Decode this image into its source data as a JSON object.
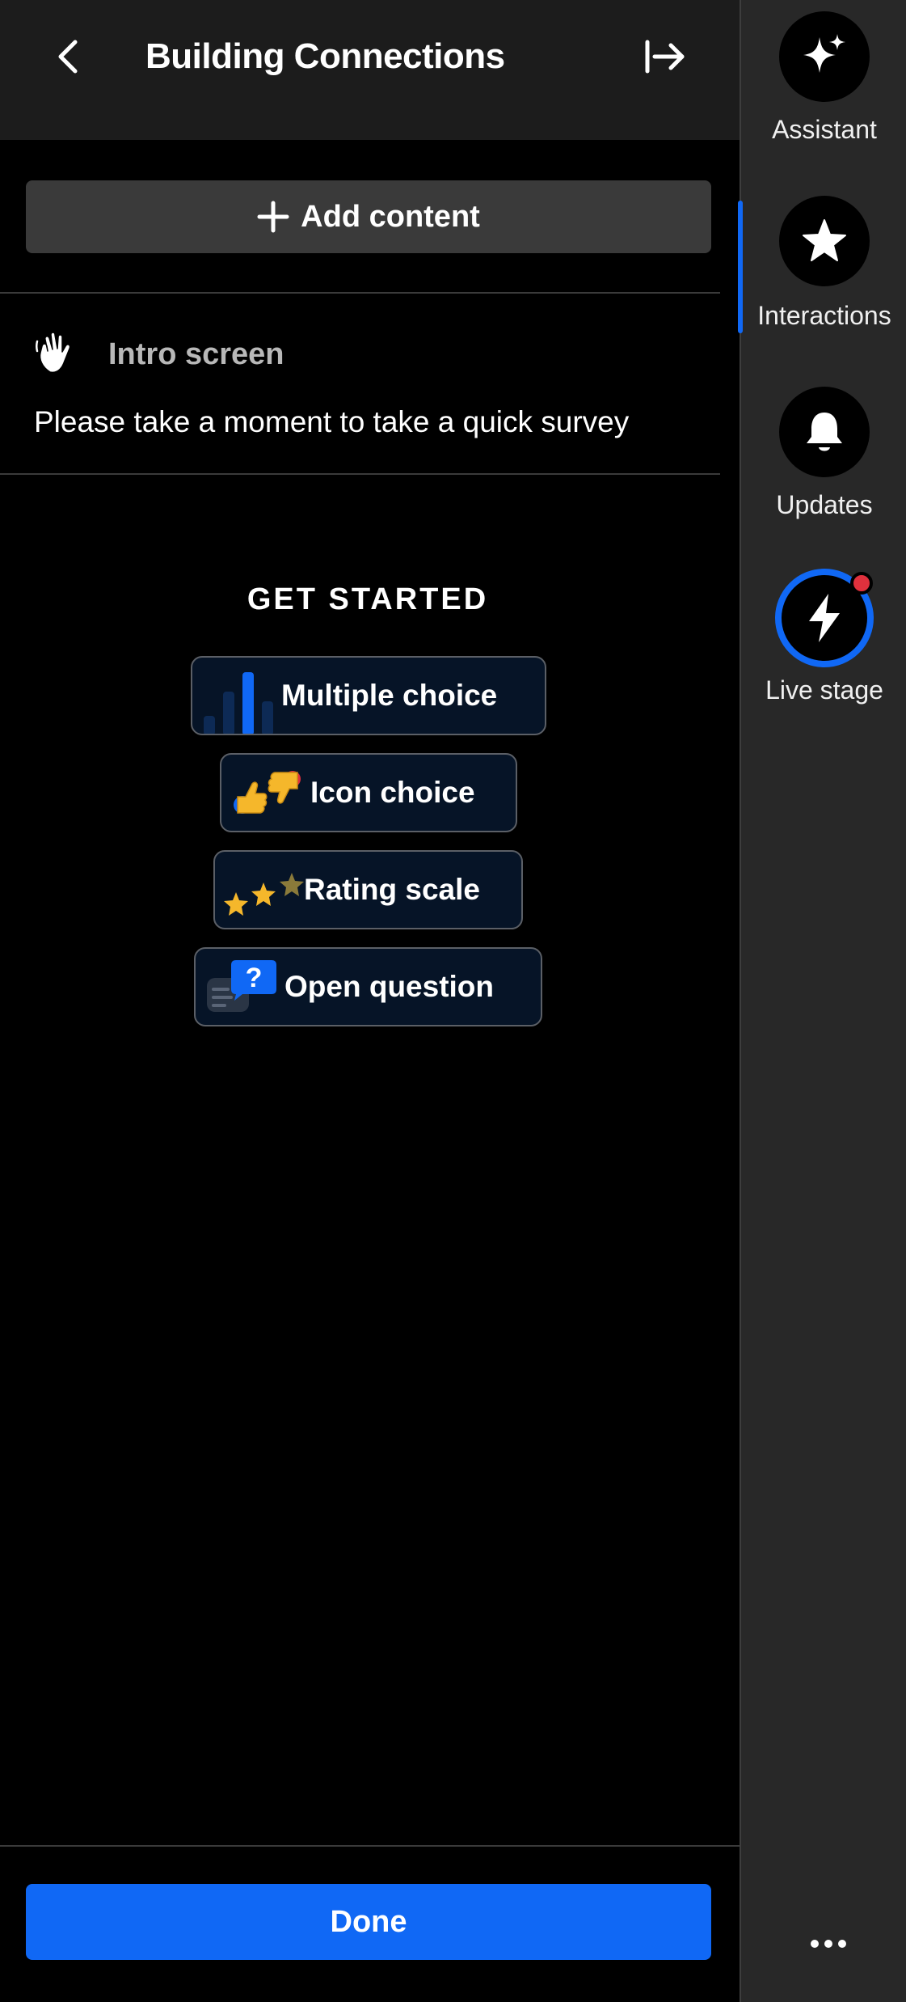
{
  "header": {
    "title": "Building Connections"
  },
  "add_content": {
    "label": "Add content"
  },
  "intro_screen": {
    "heading": "Intro screen",
    "description": "Please take a moment to take a quick survey"
  },
  "get_started": {
    "heading": "GET STARTED",
    "options": [
      {
        "label": "Multiple choice",
        "icon": "bar-chart-icon"
      },
      {
        "label": "Icon choice",
        "icon": "thumbs-icon"
      },
      {
        "label": "Rating scale",
        "icon": "stars-icon"
      },
      {
        "label": "Open question",
        "icon": "question-bubble-icon"
      }
    ]
  },
  "footer": {
    "done_label": "Done"
  },
  "rail": {
    "items": [
      {
        "label": "Assistant",
        "icon": "sparkle-icon"
      },
      {
        "label": "Interactions",
        "icon": "star-icon",
        "active": true
      },
      {
        "label": "Updates",
        "icon": "bell-icon"
      },
      {
        "label": "Live stage",
        "icon": "lightning-icon",
        "notification": true
      }
    ],
    "more": "more-icon"
  },
  "colors": {
    "accent": "#1068f5",
    "panel_bg": "#000000",
    "header_bg": "#1c1c1c",
    "rail_bg": "#282828",
    "button_bg": "#3a3a3a",
    "option_bg": "#061427",
    "notification": "#e0313d"
  }
}
